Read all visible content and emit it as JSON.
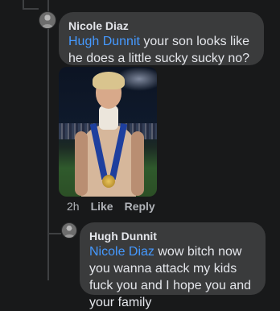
{
  "comments": [
    {
      "author": "Nicole Diaz",
      "mention": "Hugh Dunnit",
      "text": " your son looks like he does a little sucky sucky no?",
      "emoji_icon": "astonished-face-emoji",
      "has_photo": true,
      "time": "2h",
      "like_label": "Like",
      "reply_label": "Reply"
    },
    {
      "author": "Hugh Dunnit",
      "mention": "Nicole Diaz",
      "text": " wow bitch now you wanna attack my kids fuck you and I hope you and your family"
    }
  ]
}
